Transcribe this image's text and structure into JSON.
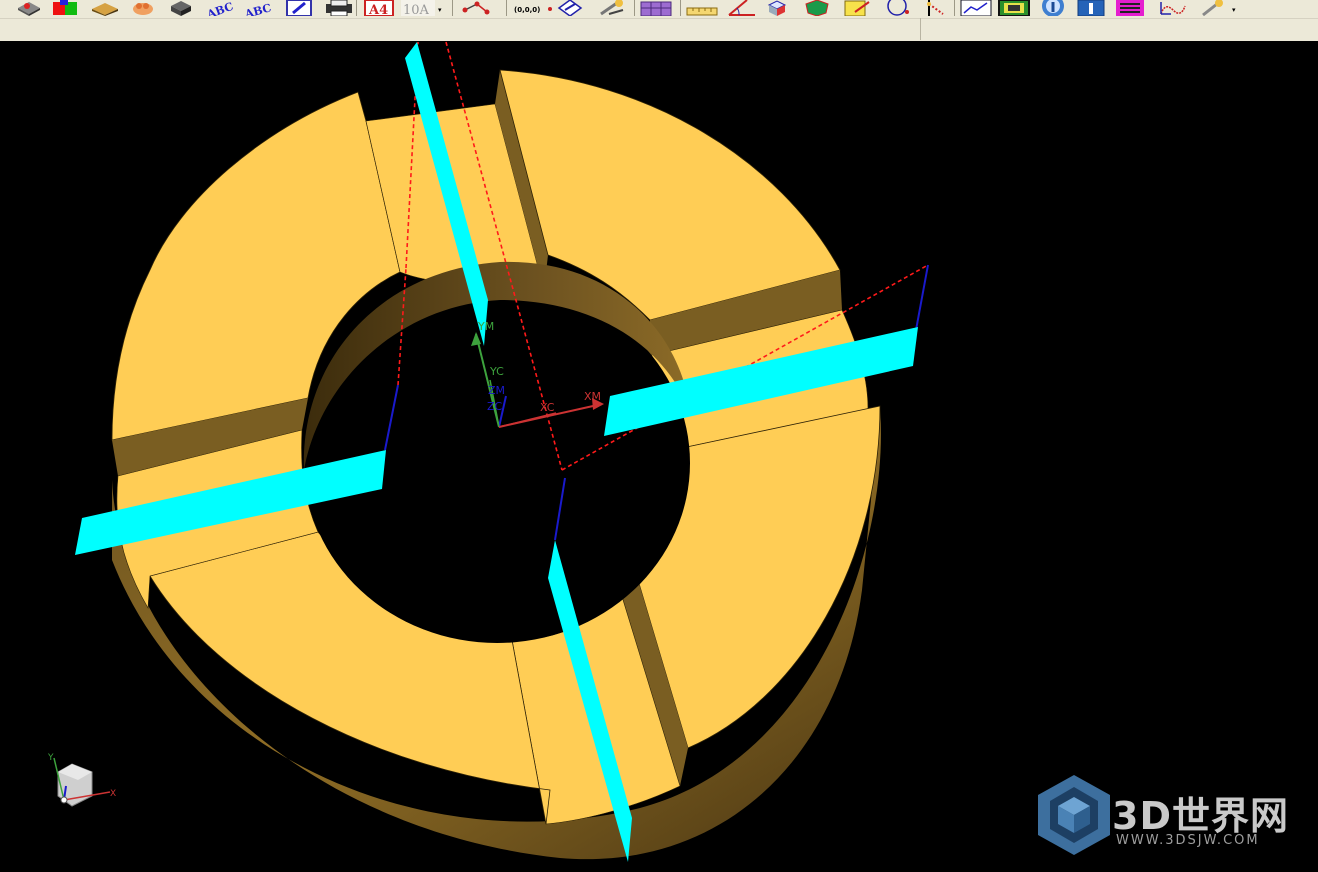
{
  "toolbar": {
    "icons": [
      {
        "name": "view-shaded-icon"
      },
      {
        "name": "color-cube-icon"
      },
      {
        "name": "edge-shaded-icon"
      },
      {
        "name": "hand-pan-icon"
      },
      {
        "name": "isometric-view-icon"
      },
      {
        "name": "text-orient-icon-1"
      },
      {
        "name": "text-orient-icon-2"
      },
      {
        "name": "edit-blue-icon"
      },
      {
        "name": "printer-icon"
      },
      {
        "name": "a4-sheet-icon"
      },
      {
        "name": "font-style-icon"
      },
      {
        "name": "network-node-icon"
      },
      {
        "name": "origin-point-icon"
      },
      {
        "name": "diamond-vector-icon"
      },
      {
        "name": "wrench-tools-icon"
      },
      {
        "name": "purple-grid-icon"
      },
      {
        "name": "ruler-icon"
      },
      {
        "name": "angle-measure-icon"
      },
      {
        "name": "cube-blue-icon"
      },
      {
        "name": "green-shield-icon"
      },
      {
        "name": "note-yellow-icon"
      },
      {
        "name": "curve-circle-icon"
      },
      {
        "name": "dotted-line-icon"
      },
      {
        "name": "chart-frame-icon"
      },
      {
        "name": "image-frame-icon"
      },
      {
        "name": "info-circle-icon"
      },
      {
        "name": "info-box-icon"
      },
      {
        "name": "layer-settings-icon"
      },
      {
        "name": "coordinate-axes-icon"
      },
      {
        "name": "wrench-key-icon"
      }
    ],
    "a4_text": "A4",
    "font_text": "10A",
    "origin_text": "(0,0,0)",
    "dropdown_glyph": "▾"
  },
  "viewport": {
    "labels": {
      "ym": "YM",
      "yc": "YC",
      "zm": "ZM",
      "zc": "ZC",
      "xc": "XC",
      "xm": "XM"
    },
    "triad": {
      "x": "X",
      "y": "Y"
    }
  },
  "watermark": {
    "title": "3D世界网",
    "url": "WWW.3DSJW.COM"
  },
  "colors": {
    "background": "#000000",
    "part_face": "#FFCD55",
    "part_side": "#5A4318",
    "slot_face": "#7A5E22",
    "plane_fill": "#00FFFF",
    "dashed_red": "#FF1A1A",
    "axis_blue": "#1A1ACC",
    "axis_green": "#3DA23D",
    "axis_red": "#CC3333",
    "toolbar_bg": "#ECE9D8"
  }
}
